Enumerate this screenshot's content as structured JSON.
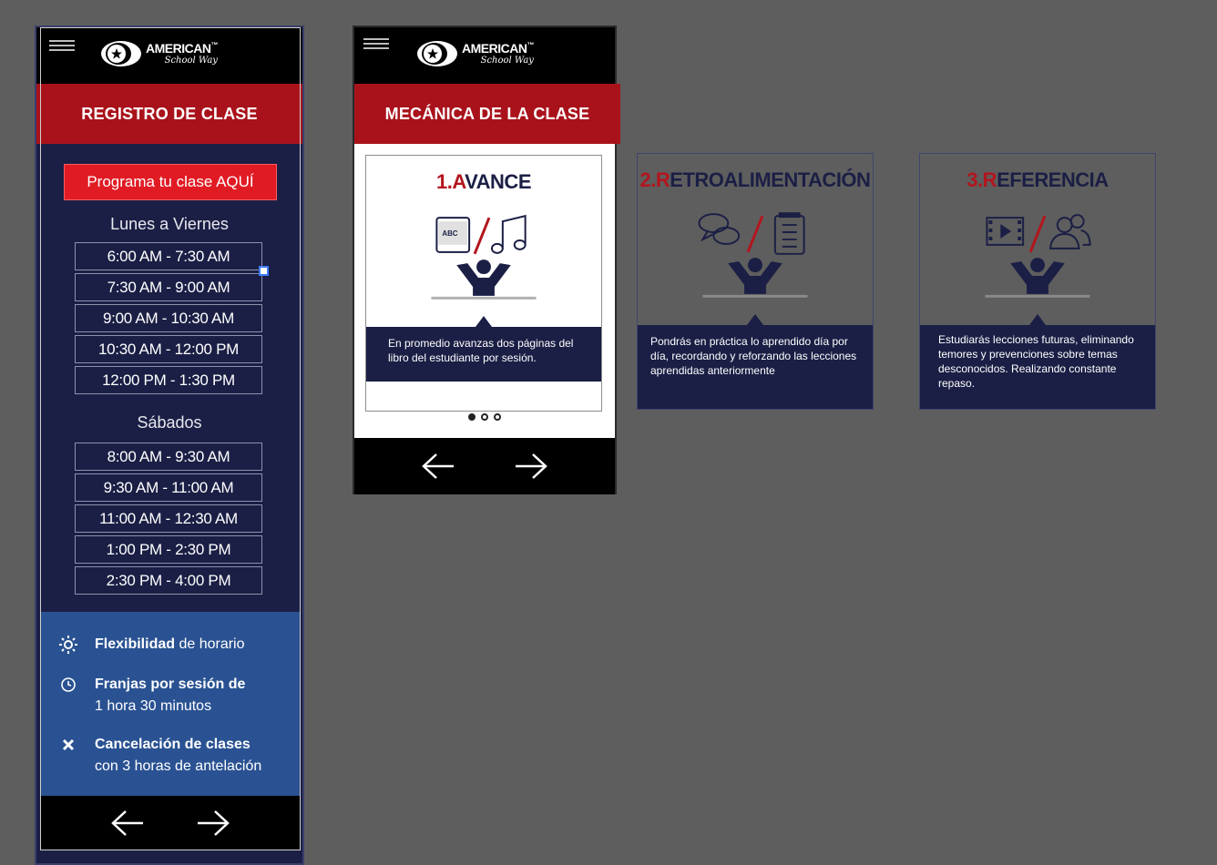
{
  "brand": {
    "name": "AMERICAN",
    "tm": "™",
    "sub": "School Way"
  },
  "screen1": {
    "header": "REGISTRO DE CLASE",
    "cta": "Programa tu clase AQUÍ",
    "weekday_label": "Lunes a Viernes",
    "weekday_slots": [
      "6:00 AM - 7:30 AM",
      "7:30 AM - 9:00 AM",
      "9:00 AM - 10:30 AM",
      "10:30 AM - 12:00 PM",
      "12:00 PM - 1:30 PM"
    ],
    "saturday_label": "Sábados",
    "saturday_slots": [
      "8:00 AM - 9:30 AM",
      "9:30 AM - 11:00 AM",
      "11:00 AM - 12:30 AM",
      "1:00 PM - 2:30 PM",
      "2:30 PM - 4:00 PM"
    ],
    "benefits": [
      {
        "icon": "sun-icon",
        "bold": "Flexibilidad",
        "text": " de horario",
        "line2": ""
      },
      {
        "icon": "clock-icon",
        "bold": "Franjas por sesión de",
        "text": "",
        "line2": "1 hora 30 minutos"
      },
      {
        "icon": "x-icon",
        "bold": "Cancelación de clases",
        "text": "",
        "line2": "con 3 horas de antelación"
      }
    ]
  },
  "screen2": {
    "header": "MECÁNICA DE LA CLASE",
    "card1": {
      "num": "1.A",
      "rest": "VANCE",
      "desc": "En promedio avanzas dos páginas del libro del estudiante por sesión."
    }
  },
  "card2": {
    "num": "2.R",
    "rest": "ETROALIMENTACIÓN",
    "desc": "Pondrás en práctica lo aprendido día por día, recordando y reforzando las lecciones aprendidas anteriormente"
  },
  "card3": {
    "num": "3.R",
    "rest": "EFERENCIA",
    "desc": "Estudiarás lecciones futuras, eliminando temores y prevenciones sobre temas desconocidos. Realizando constante repaso."
  },
  "colors": {
    "navy": "#1b1f45",
    "red": "#a9121b",
    "cta_red": "#e01b24",
    "blue": "#2a5292",
    "background": "#5e5e5e"
  }
}
